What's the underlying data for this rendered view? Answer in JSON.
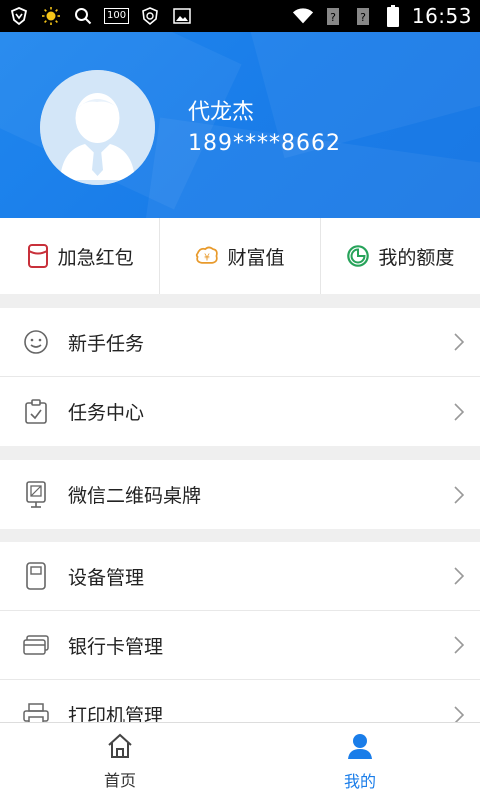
{
  "status_bar": {
    "battery_text": "100",
    "time": "16:53"
  },
  "profile": {
    "name": "代龙杰",
    "phone": "189****8662"
  },
  "quick_actions": [
    {
      "label": "加急红包",
      "icon": "red-envelope-icon",
      "color": "#c8303a"
    },
    {
      "label": "财富值",
      "icon": "wealth-icon",
      "color": "#e89a2c"
    },
    {
      "label": "我的额度",
      "icon": "credit-limit-icon",
      "color": "#27a35a"
    }
  ],
  "menu_groups": [
    [
      {
        "label": "新手任务",
        "icon": "smile-icon"
      },
      {
        "label": "任务中心",
        "icon": "clipboard-check-icon"
      }
    ],
    [
      {
        "label": "微信二维码桌牌",
        "icon": "qr-stand-icon"
      }
    ],
    [
      {
        "label": "设备管理",
        "icon": "device-icon"
      },
      {
        "label": "银行卡管理",
        "icon": "bank-card-icon"
      },
      {
        "label": "打印机管理",
        "icon": "printer-icon"
      }
    ]
  ],
  "bottom_nav": [
    {
      "label": "首页",
      "icon": "home-icon",
      "active": false
    },
    {
      "label": "我的",
      "icon": "person-icon",
      "active": true
    }
  ],
  "colors": {
    "header_blue": "#1a7de9",
    "active_tab": "#1a7de9"
  }
}
